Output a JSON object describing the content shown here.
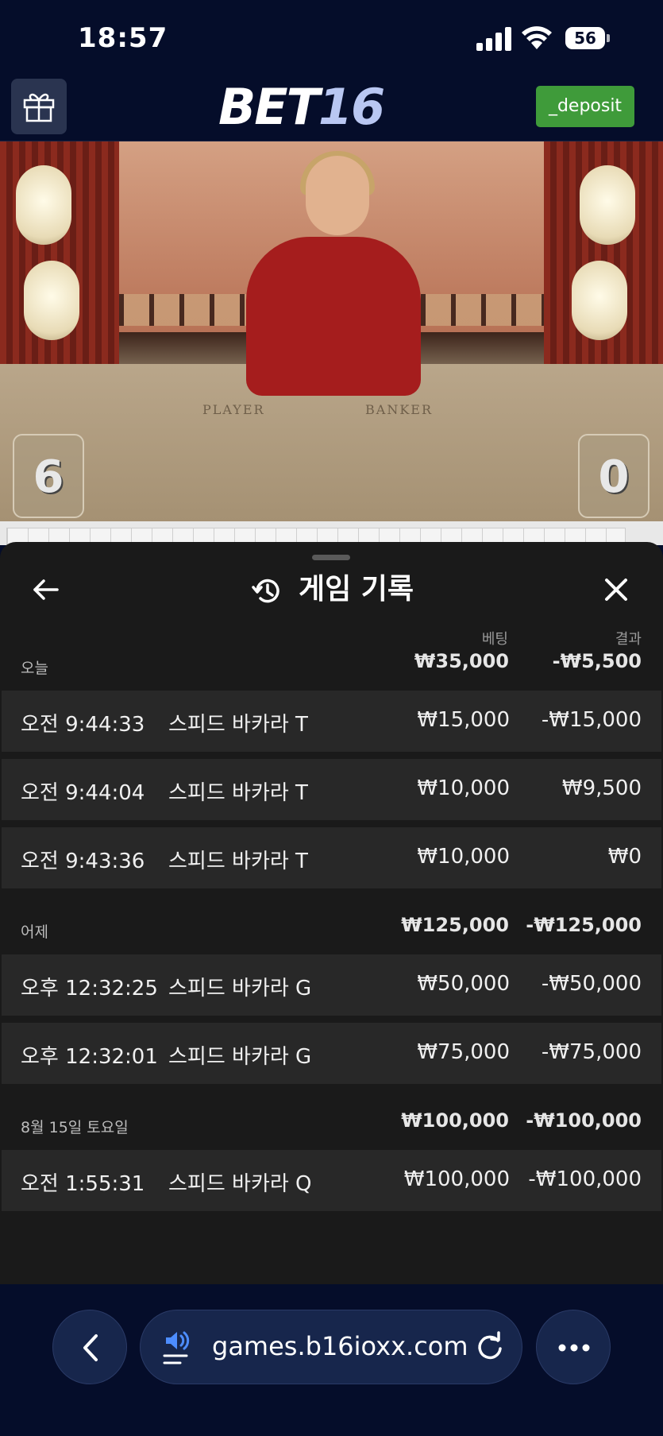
{
  "status": {
    "time": "18:57",
    "battery": "56"
  },
  "header": {
    "logo_part1": "BET",
    "logo_part2": "16",
    "deposit_label": "_deposit"
  },
  "video": {
    "player_label": "PLAYER",
    "banker_label": "BANKER",
    "player_score": "6",
    "banker_score": "0"
  },
  "history": {
    "title": "게임 기록",
    "col_bet": "베팅",
    "col_result": "결과",
    "groups": [
      {
        "label": "오늘",
        "bet_total": "₩35,000",
        "result_total": "-₩5,500",
        "rows": [
          {
            "time": "오전 9:44:33",
            "game": "스피드 바카라 T",
            "bet": "₩15,000",
            "result": "-₩15,000"
          },
          {
            "time": "오전 9:44:04",
            "game": "스피드 바카라 T",
            "bet": "₩10,000",
            "result": "₩9,500"
          },
          {
            "time": "오전 9:43:36",
            "game": "스피드 바카라 T",
            "bet": "₩10,000",
            "result": "₩0"
          }
        ]
      },
      {
        "label": "어제",
        "bet_total": "₩125,000",
        "result_total": "-₩125,000",
        "rows": [
          {
            "time": "오후 12:32:25",
            "game": "스피드 바카라 G",
            "bet": "₩50,000",
            "result": "-₩50,000"
          },
          {
            "time": "오후 12:32:01",
            "game": "스피드 바카라 G",
            "bet": "₩75,000",
            "result": "-₩75,000"
          }
        ]
      },
      {
        "label": "8월 15일 토요일",
        "bet_total": "₩100,000",
        "result_total": "-₩100,000",
        "rows": [
          {
            "time": "오전 1:55:31",
            "game": "스피드 바카라 Q",
            "bet": "₩100,000",
            "result": "-₩100,000"
          }
        ]
      }
    ]
  },
  "browser": {
    "url": "games.b16ioxx.com"
  },
  "icons": {
    "gift": "gift-icon",
    "back": "arrow-left-icon",
    "history": "history-icon",
    "close": "close-icon",
    "nav_back": "chevron-left-icon",
    "speaker": "speaker-icon",
    "reload": "reload-icon",
    "more": "more-icon"
  },
  "colors": {
    "deposit_green": "#3f9b3a",
    "page_bg": "#050d2a",
    "panel_bg": "#1a1a1a",
    "row_bg": "#282828"
  }
}
